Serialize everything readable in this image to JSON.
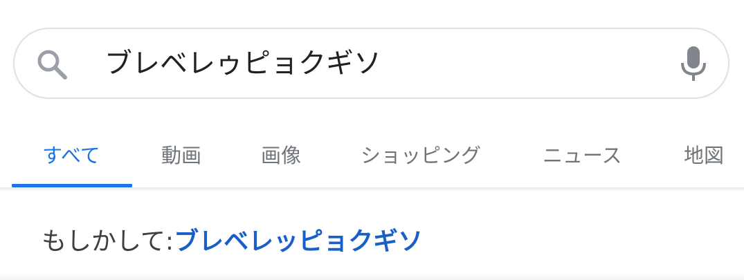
{
  "search": {
    "query": "ブレベレゥピョクギソ",
    "search_icon": "search-icon",
    "mic_icon": "microphone-icon"
  },
  "tabs": [
    {
      "label": "すべて",
      "active": true
    },
    {
      "label": "動画",
      "active": false
    },
    {
      "label": "画像",
      "active": false
    },
    {
      "label": "ショッピング",
      "active": false
    },
    {
      "label": "ニュース",
      "active": false
    },
    {
      "label": "地図",
      "active": false
    }
  ],
  "suggestion": {
    "prefix": "もしかして: ",
    "corrected_query": "ブレベレッピョクギソ"
  },
  "colors": {
    "accent": "#1a73e8",
    "link": "#1a5fc7",
    "tab_inactive": "#70757a",
    "border": "#dfe1e5"
  }
}
